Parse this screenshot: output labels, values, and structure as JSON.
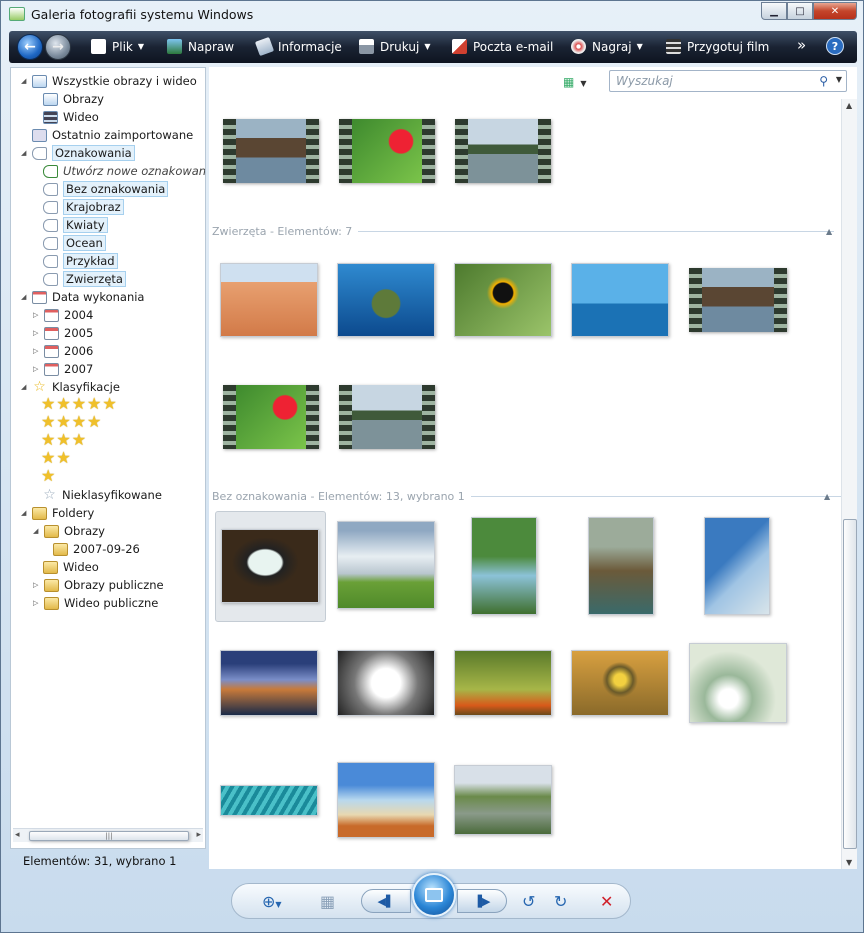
{
  "window": {
    "title": "Galeria fotografii systemu Windows"
  },
  "toolbar": {
    "items": [
      {
        "label": "Plik",
        "icon": "file-icon",
        "caret": true
      },
      {
        "label": "Napraw",
        "icon": "fix-icon",
        "caret": false
      },
      {
        "label": "Informacje",
        "icon": "info-icon",
        "caret": false
      },
      {
        "label": "Drukuj",
        "icon": "printer-icon",
        "caret": true
      },
      {
        "label": "Poczta e-mail",
        "icon": "email-icon",
        "caret": false
      },
      {
        "label": "Nagraj",
        "icon": "burn-disc-icon",
        "caret": true
      },
      {
        "label": "Przygotuj film",
        "icon": "movie-icon",
        "caret": false
      }
    ],
    "more": "»",
    "help": "?"
  },
  "search": {
    "placeholder": "Wyszukaj"
  },
  "tree": {
    "all": "Wszystkie obrazy i wideo",
    "images": "Obrazy",
    "video": "Wideo",
    "recent": "Ostatnio zaimportowane",
    "tags": "Oznakowania",
    "new_tag": "Utwórz nowe oznakowanie",
    "no_tag": "Bez oznakowania",
    "tag_list": [
      "Krajobraz",
      "Kwiaty",
      "Ocean",
      "Przykład",
      "Zwierzęta"
    ],
    "date": "Data wykonania",
    "years": [
      "2004",
      "2005",
      "2006",
      "2007"
    ],
    "ratings": "Klasyfikacje",
    "unrated": "Nieklasyfikowane",
    "folders": "Foldery",
    "folder_images": "Obrazy",
    "folder_date": "2007-09-26",
    "folder_video": "Wideo",
    "public_images": "Obrazy publiczne",
    "public_video": "Wideo publiczne"
  },
  "groups": {
    "animals": "Zwierzęta - Elementów: 7",
    "untagged": "Bez oznakowania - Elementów: 13, wybrano 1"
  },
  "status": {
    "text": "Elementów: 31, wybrano 1"
  },
  "colors": {
    "accent": "#2b86d6",
    "toolbar": "#1a2333",
    "close": "#c4452b"
  }
}
